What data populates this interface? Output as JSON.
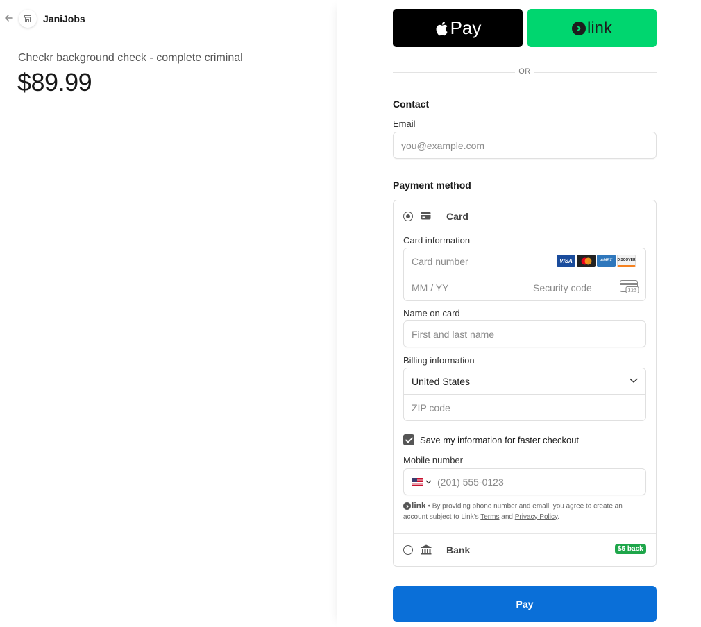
{
  "header": {
    "merchant_name": "JaniJobs"
  },
  "product": {
    "name": "Checkr background check - complete criminal",
    "price": "$89.99"
  },
  "express": {
    "apple_pay_label": "Pay",
    "link_label": "link",
    "or_label": "OR"
  },
  "contact": {
    "title": "Contact",
    "email_label": "Email",
    "email_placeholder": "you@example.com"
  },
  "payment": {
    "title": "Payment method",
    "card_option_label": "Card",
    "card_info_label": "Card information",
    "card_number_placeholder": "Card number",
    "expiry_placeholder": "MM / YY",
    "cvc_placeholder": "Security code",
    "cvc_icon_text": "123",
    "brands": [
      {
        "name": "VISA",
        "bg": "#1a4c9c",
        "fg": "#ffffff"
      },
      {
        "name": "mastercard",
        "bg": "#222222",
        "fg": "#ffffff"
      },
      {
        "name": "AMEX",
        "bg": "#2e77bc",
        "fg": "#ffffff"
      },
      {
        "name": "DISCOVER",
        "bg": "#f4f4f4",
        "fg": "#222222"
      }
    ],
    "name_label": "Name on card",
    "name_placeholder": "First and last name",
    "billing_label": "Billing information",
    "country_value": "United States",
    "zip_placeholder": "ZIP code",
    "save_info_label": "Save my information for faster checkout",
    "save_info_checked": true,
    "mobile_label": "Mobile number",
    "mobile_placeholder": "(201) 555-0123",
    "legal_link_word": "link",
    "legal_text_1": " • By providing phone number and email, you agree to create an account subject to Link's ",
    "legal_terms": "Terms",
    "legal_and": " and ",
    "legal_privacy": "Privacy Policy",
    "legal_end": ".",
    "bank_option_label": "Bank",
    "bank_badge": "$5 back"
  },
  "pay_button_label": "Pay",
  "colors": {
    "apple_pay": "#000000",
    "link_green": "#00d66f",
    "pay_blue": "#0a6fd8",
    "badge_green": "#1ea64a"
  }
}
